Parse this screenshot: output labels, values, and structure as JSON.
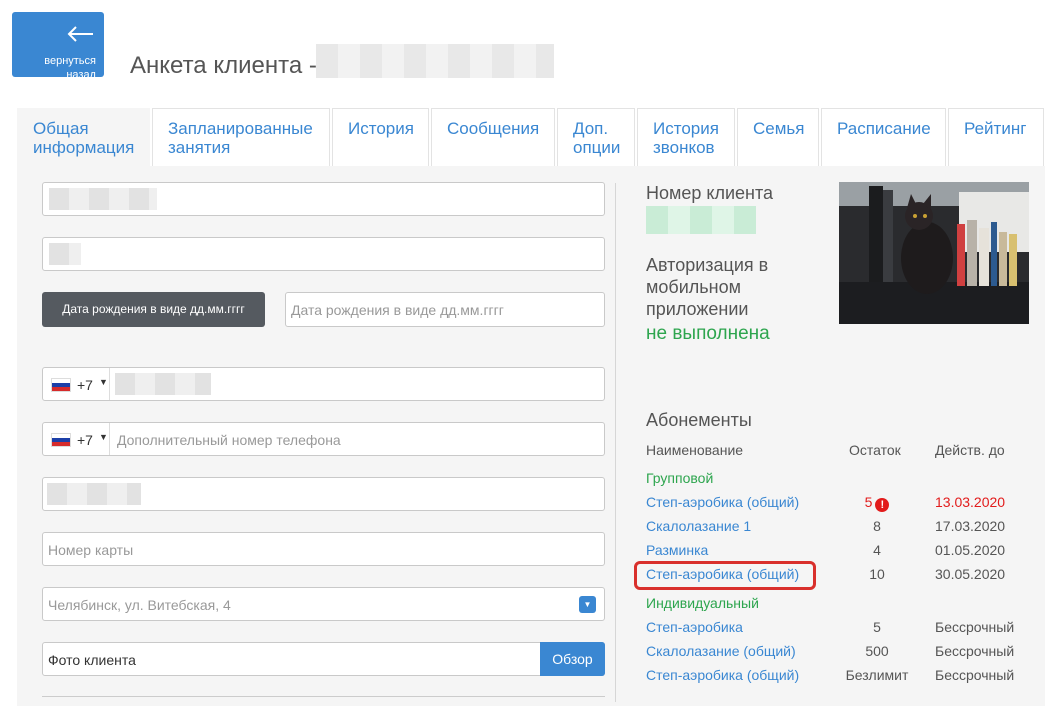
{
  "header": {
    "back_line1": "вернуться",
    "back_line2": "назад",
    "title": "Анкета клиента -"
  },
  "tabs": [
    {
      "line1": "Общая",
      "line2": "информация"
    },
    {
      "line1": "Запланированные",
      "line2": "занятия"
    },
    {
      "line1": "История",
      "line2": ""
    },
    {
      "line1": "Сообщения",
      "line2": ""
    },
    {
      "line1": "Доп.",
      "line2": "опции"
    },
    {
      "line1": "История",
      "line2": "звонков"
    },
    {
      "line1": "Семья",
      "line2": ""
    },
    {
      "line1": "Расписание",
      "line2": ""
    },
    {
      "line1": "Рейтинг",
      "line2": ""
    }
  ],
  "form": {
    "dob_button": "Дата рождения в виде дд.мм.гггг",
    "dob_placeholder": "Дата рождения в виде дд.мм.гггг",
    "phone_code": "+7",
    "extra_phone_code": "+7",
    "extra_phone_placeholder": "Дополнительный номер телефона",
    "card_placeholder": "Номер карты",
    "location_value": "Челябинск, ул. Витебская, 4",
    "photo_label": "Фото клиента",
    "browse_button": "Обзор"
  },
  "client": {
    "number_label": "Номер клиента",
    "auth_label": "Авторизация в мобильном приложении",
    "auth_status": "не выполнена"
  },
  "subscriptions": {
    "title": "Абонементы",
    "col_name": "Наименование",
    "col_remaining": "Остаток",
    "col_valid": "Действ. до",
    "group_label": "Групповой",
    "individual_label": "Индивидуальный",
    "group": [
      {
        "name": "Степ-аэробика (общий)",
        "remaining": "5",
        "valid": "13.03.2020"
      },
      {
        "name": "Скалолазание 1",
        "remaining": "8",
        "valid": "17.03.2020"
      },
      {
        "name": "Разминка",
        "remaining": "4",
        "valid": "01.05.2020"
      },
      {
        "name": "Степ-аэробика (общий)",
        "remaining": "10",
        "valid": "30.05.2020"
      }
    ],
    "individual": [
      {
        "name": "Степ-аэробика",
        "remaining": "5",
        "valid": "Бессрочный"
      },
      {
        "name": "Скалолазание (общий)",
        "remaining": "500",
        "valid": "Бессрочный"
      },
      {
        "name": "Степ-аэробика (общий)",
        "remaining": "Безлимит",
        "valid": "Бессрочный"
      }
    ]
  },
  "colors": {
    "accent": "#3a87d2",
    "success": "#2da54e",
    "danger": "#e21b1b",
    "highlight": "#d9302c"
  }
}
